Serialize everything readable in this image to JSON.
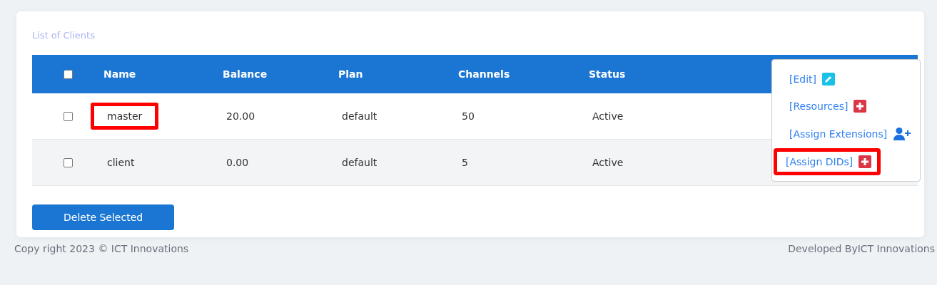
{
  "card": {
    "title": "List of Clients"
  },
  "table": {
    "header_checkbox": {
      "checked": false
    },
    "columns": [
      "Name",
      "Balance",
      "Plan",
      "Channels",
      "Status"
    ],
    "rows": [
      {
        "checked": false,
        "highlighted": true,
        "cells": [
          "master",
          "20.00",
          "default",
          "50",
          "Active"
        ]
      },
      {
        "checked": false,
        "highlighted": false,
        "cells": [
          "client",
          "0.00",
          "default",
          "5",
          "Active"
        ]
      }
    ]
  },
  "actions_menu": {
    "items": [
      {
        "label": "[Edit]",
        "kind": "edit",
        "highlighted": false
      },
      {
        "label": "[Resources]",
        "kind": "plus",
        "highlighted": false
      },
      {
        "label": "[Assign Extensions]",
        "kind": "user",
        "highlighted": false
      },
      {
        "label": "[Assign DIDs]",
        "kind": "plus",
        "highlighted": true
      }
    ]
  },
  "delete_button": "Delete Selected",
  "footer": {
    "copyright": "Copy right 2023 © ICT Innovations",
    "credit": "Developed ByICT Innovations"
  }
}
